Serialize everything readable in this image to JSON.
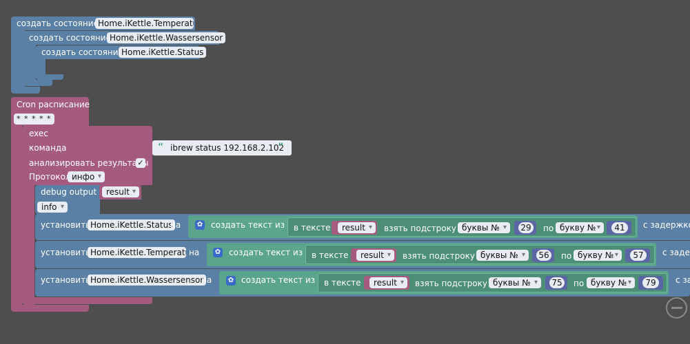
{
  "create_state_label": "создать состояние",
  "states": {
    "temperatur": "Home.iKettle.Temperatur",
    "wassersensor": "Home.iKettle.Wassersensor",
    "status": "Home.iKettle.Status"
  },
  "cron": {
    "label": "Cron расписание",
    "schedule": "* * * * *"
  },
  "exec": {
    "label": "exec",
    "command_label": "команда",
    "command_value": "ibrew status 192.168.2.102",
    "analyze_label": "анализировать результаты",
    "analyze_checked_glyph": "✓",
    "protocol_label": "Протокол",
    "protocol_value": "инфо"
  },
  "debug": {
    "label": "debug output",
    "var": "result",
    "level": "info"
  },
  "set_label": "установить",
  "on_label": "на",
  "text_create_label": "создать текст из",
  "in_text_label": "в тексте",
  "substring_label": "взять подстроку с",
  "from_mode": "буквы №",
  "to_label": "по",
  "to_mode": "букву №",
  "delay_label_1": "с задержкой",
  "delay_label_2": "с задер",
  "delay_label_3": "с за",
  "result_var": "result",
  "rows": [
    {
      "state": "Home.iKettle.Status",
      "from": "29",
      "to": "41"
    },
    {
      "state": "Home.iKettle.Temperatur",
      "from": "56",
      "to": "57"
    },
    {
      "state": "Home.iKettle.Wassersensor",
      "from": "75",
      "to": "79"
    }
  ],
  "zoom_out_icon": "minus-circle-icon",
  "gear_icon": "gear-icon",
  "quote_icon": "quote-icon"
}
